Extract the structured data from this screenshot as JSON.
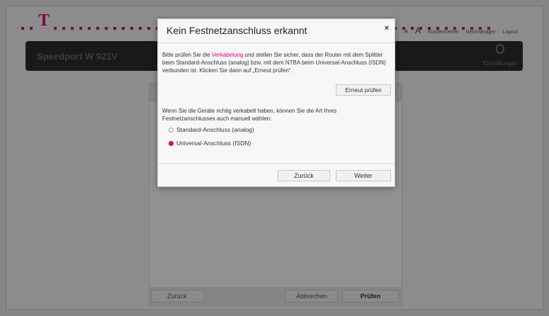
{
  "header": {
    "brand_letter": "T",
    "font_small": "A",
    "font_large": "A",
    "link_customer_center": "Kundencenter",
    "link_network_manager": "Netzmanager",
    "link_logout": "Logout",
    "brand_color": "#e20074"
  },
  "device_bar": {
    "device_name": "Speedport W 921V",
    "settings_label": "Einstellungen"
  },
  "background_panel": {
    "back_label": "Zurück",
    "cancel_label": "Abbrechen",
    "check_label": "Prüfen"
  },
  "dialog": {
    "title": "Kein Festnetzanschluss erkannt",
    "close_symbol": "×",
    "text_before_link": "Bitte prüfen Sie die ",
    "link_text": "Verkabelung",
    "text_after_link": " und stellen Sie sicher, dass der Router mit dem Splitter beim Standard-Anschluss (analog) bzw. mit dem NTBA beim Universal-Anschluss (ISDN) verbunden ist. Klicken Sie dann auf „Erneut prüfen“.",
    "recheck_label": "Erneut prüfen",
    "manual_text": "Wenn Sie die Geräte richtig verkabelt haben, können Sie die Art Ihres Festnetzanschlusses auch manuell wählen:",
    "options": [
      {
        "label": "Standard-Anschluss (analog)",
        "selected": false
      },
      {
        "label": "Universal-Anschluss (ISDN)",
        "selected": true
      }
    ],
    "back_label": "Zurück",
    "next_label": "Weiter"
  }
}
